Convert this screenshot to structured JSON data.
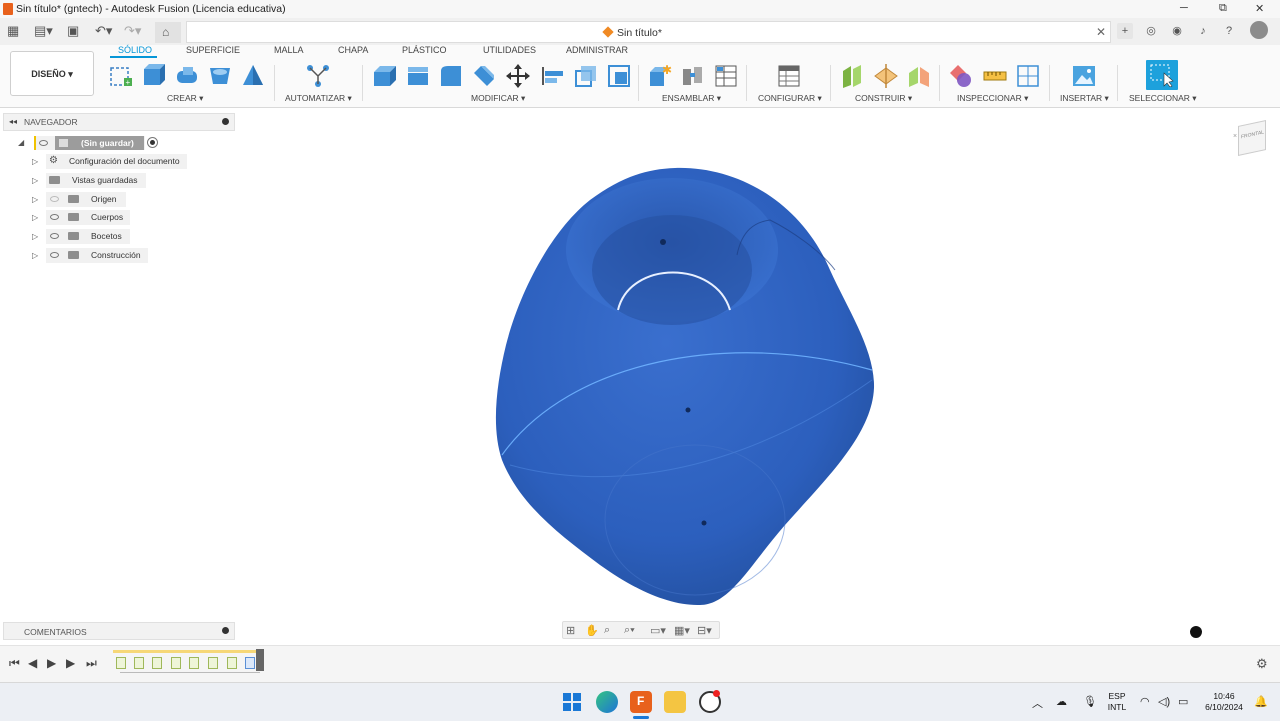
{
  "window": {
    "title": "Sin título* (gntech) - Autodesk Fusion (Licencia educativa)",
    "controls": [
      "─",
      "⧉",
      "✕"
    ]
  },
  "document_tab": {
    "label": "Sin título*",
    "close": "✕"
  },
  "workspace_button": "DISEÑO ▾",
  "tabs": [
    "SÓLIDO",
    "SUPERFICIE",
    "MALLA",
    "CHAPA",
    "PLÁSTICO",
    "UTILIDADES",
    "ADMINISTRAR"
  ],
  "active_tab": "SÓLIDO",
  "tool_groups": [
    "CREAR ▾",
    "AUTOMATIZAR ▾",
    "MODIFICAR ▾",
    "ENSAMBLAR ▾",
    "CONFIGURAR ▾",
    "CONSTRUIR ▾",
    "INSPECCIONAR ▾",
    "INSERTAR ▾",
    "SELECCIONAR ▾"
  ],
  "browser": {
    "title": "NAVEGADOR",
    "collapse": "◂◂",
    "root": "(Sin guardar)",
    "items": [
      "Configuración del documento",
      "Vistas guardadas",
      "Origen",
      "Cuerpos",
      "Bocetos",
      "Construcción"
    ]
  },
  "comments": {
    "title": "COMENTARIOS"
  },
  "viewcube_label": "FRONTAL",
  "taskbar": {
    "lang_top": "ESP",
    "lang_bottom": "INTL",
    "time": "10:46",
    "date": "6/10/2024"
  },
  "colors": {
    "accent": "#0696d7",
    "body_blue": "#2e63c0",
    "fusion_orange": "#e8611c"
  }
}
